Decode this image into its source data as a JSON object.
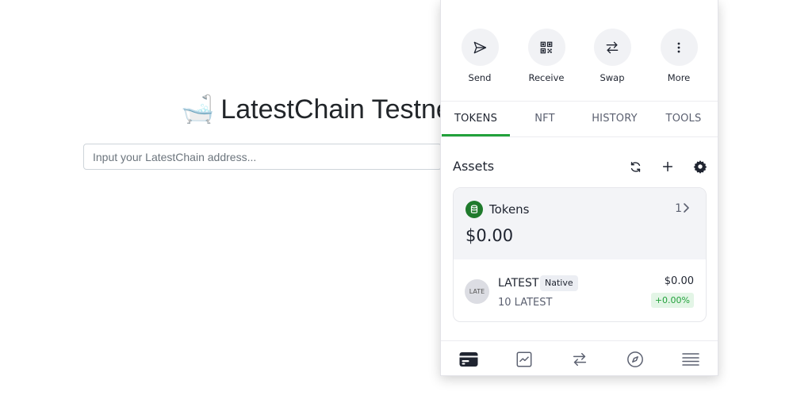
{
  "page": {
    "title": "LatestChain Testnet",
    "title_icon": "bathtub",
    "address_placeholder": "Input your LatestChain address..."
  },
  "wallet": {
    "actions": [
      {
        "label": "Send",
        "icon": "send-icon"
      },
      {
        "label": "Receive",
        "icon": "qr-code-icon"
      },
      {
        "label": "Swap",
        "icon": "swap-icon"
      },
      {
        "label": "More",
        "icon": "more-vertical-icon"
      }
    ],
    "tabs": [
      {
        "label": "TOKENS",
        "active": true
      },
      {
        "label": "NFT",
        "active": false
      },
      {
        "label": "HISTORY",
        "active": false
      },
      {
        "label": "TOOLS",
        "active": false
      }
    ],
    "assets": {
      "title": "Assets",
      "icons": [
        "refresh-icon",
        "plus-icon",
        "gear-icon"
      ]
    },
    "tokens": {
      "label": "Tokens",
      "count": "1",
      "total": "$0.00",
      "items": [
        {
          "avatar_text": "LATE",
          "name": "LATEST",
          "tag": "Native",
          "amount": "10 LATEST",
          "value": "$0.00",
          "change": "+0.00%"
        }
      ]
    },
    "bottom_nav": [
      "wallet-card-icon",
      "chart-icon",
      "swap-icon",
      "compass-icon",
      "menu-icon"
    ],
    "colors": {
      "accent": "#22a13b",
      "token_badge": "#1f7a2c",
      "change_bg": "#e3f5e6"
    }
  }
}
